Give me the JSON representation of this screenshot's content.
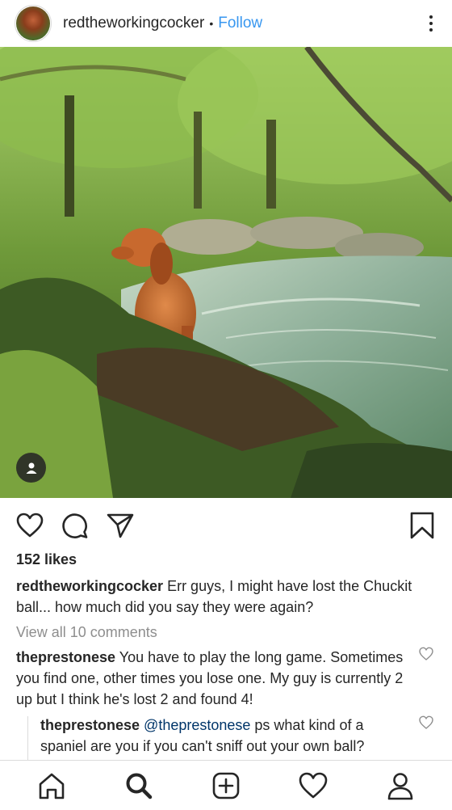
{
  "post": {
    "username": "redtheworkingcocker",
    "separator": "•",
    "follow_label": "Follow",
    "likes": "152 likes",
    "caption_user": "redtheworkingcocker",
    "caption_text": " Err guys, I might have lost the Chuckit ball... how much did you say they were again?",
    "view_all_comments": "View all 10 comments"
  },
  "comments": [
    {
      "user": "theprestonese",
      "text": " You have to play the long game. Sometimes you find one, other times you lose one. My guy is currently 2 up but I think he's lost 2 and found 4!"
    },
    {
      "user": "theprestonese",
      "mention": " @theprestonese",
      "text": " ps what kind of a spaniel are you if you can't sniff out your own ball?"
    }
  ],
  "icons": {
    "more": "more-options-icon",
    "tag": "user-tag-icon",
    "like": "heart-icon",
    "comment": "comment-icon",
    "share": "send-icon",
    "save": "bookmark-icon",
    "home": "home-icon",
    "search": "search-icon",
    "create": "add-post-icon",
    "activity": "activity-heart-icon",
    "profile": "profile-icon"
  },
  "colors": {
    "link_blue": "#3897f0",
    "text": "#262626",
    "muted": "#8e8e8e",
    "mention": "#003569"
  }
}
